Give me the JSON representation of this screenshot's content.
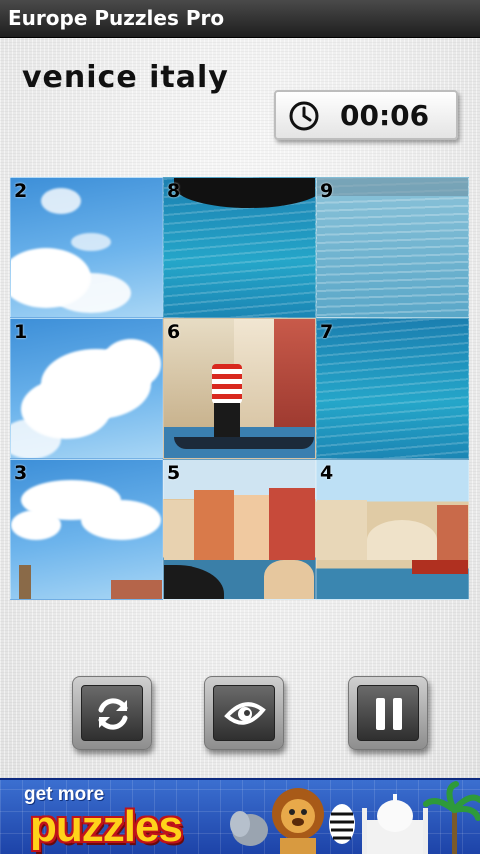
{
  "app": {
    "title": "Europe Puzzles Pro"
  },
  "puzzle": {
    "name": "venice italy"
  },
  "timer": {
    "value": "00:06",
    "icon": "clock-icon"
  },
  "board": {
    "tiles": [
      {
        "label": "2",
        "scene": "sky-clouds"
      },
      {
        "label": "8",
        "scene": "water-gondola-hull"
      },
      {
        "label": "9",
        "scene": "light-water"
      },
      {
        "label": "1",
        "scene": "big-cloud"
      },
      {
        "label": "6",
        "scene": "gondolier-buildings"
      },
      {
        "label": "7",
        "scene": "water"
      },
      {
        "label": "3",
        "scene": "sky-tower"
      },
      {
        "label": "5",
        "scene": "grand-canal-buildings"
      },
      {
        "label": "4",
        "scene": "rialto-bridge"
      }
    ]
  },
  "controls": {
    "shuffle": {
      "icon": "refresh-icon"
    },
    "preview": {
      "icon": "eye-icon"
    },
    "pause": {
      "icon": "pause-icon"
    }
  },
  "ad": {
    "line1": "get more",
    "line2": "puzzles",
    "colors": {
      "background": "#2a58c0",
      "headline": "#ffd21a",
      "outline": "#c0131a"
    }
  }
}
